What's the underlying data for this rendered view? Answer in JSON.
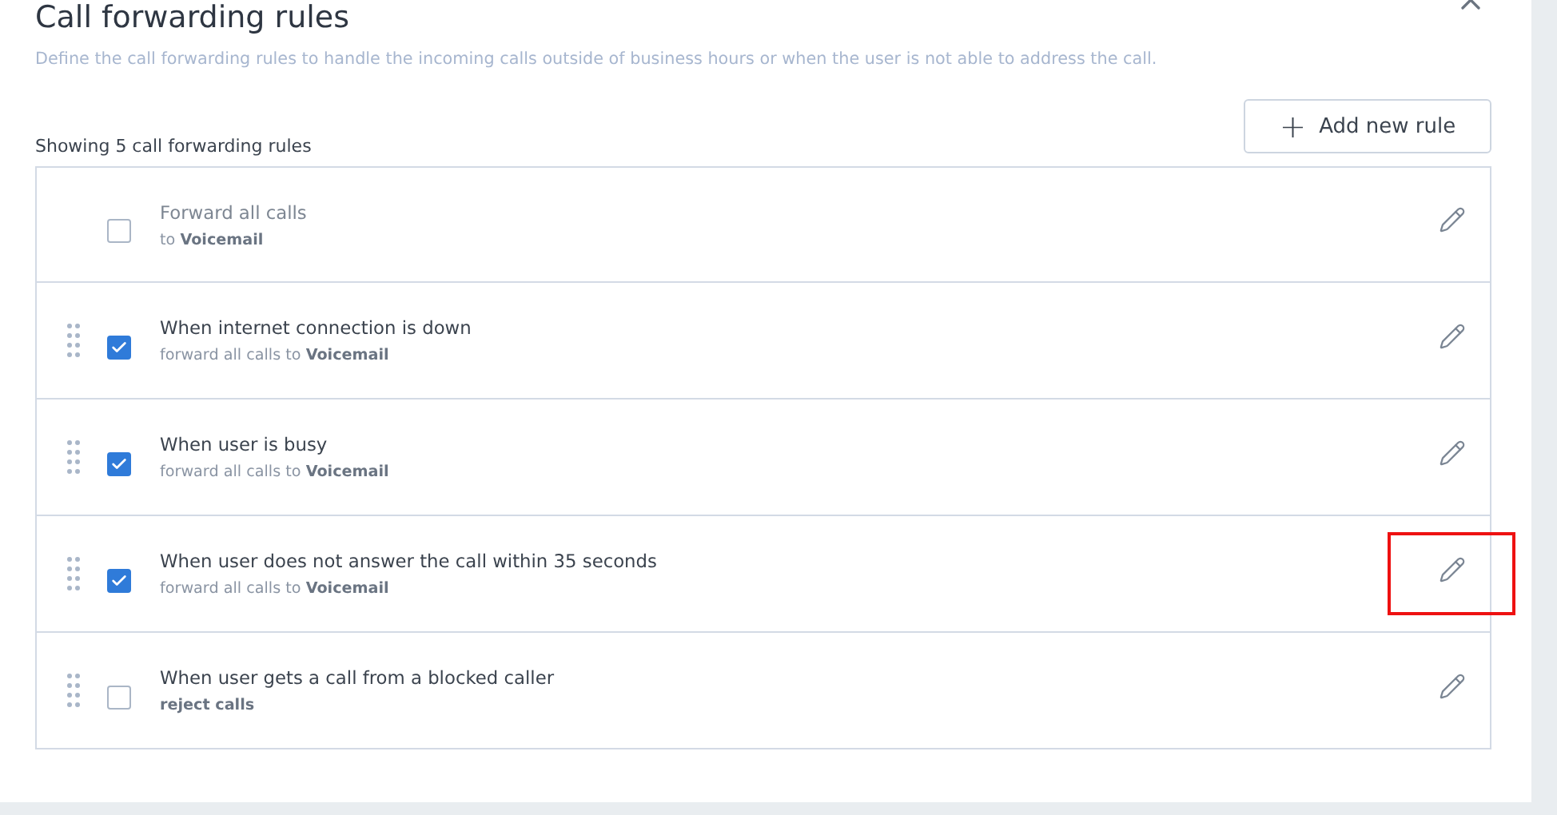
{
  "dialog": {
    "title": "Call forwarding rules",
    "description": "Define the call forwarding rules to handle the incoming calls outside of business hours or when the user is not able to address the call."
  },
  "summary": "Showing 5 call forwarding rules",
  "add_button": {
    "icon": "+",
    "label": "Add new rule"
  },
  "rules": [
    {
      "title": "Forward all calls",
      "detail": "to **Voicemail**",
      "checked": false,
      "draggable": false,
      "highlighted": false
    },
    {
      "title": "When internet connection is down",
      "detail": "forward all calls to **Voicemail**",
      "checked": true,
      "draggable": true,
      "highlighted": false
    },
    {
      "title": "When user is busy",
      "detail": "forward all calls to **Voicemail**",
      "checked": true,
      "draggable": true,
      "highlighted": false
    },
    {
      "title": "When user does not answer the call within 35 seconds",
      "detail": "forward all calls to **Voicemail**",
      "checked": true,
      "draggable": true,
      "highlighted": true
    },
    {
      "title": "When user gets a call from a blocked caller",
      "detail": "**reject calls**",
      "checked": false,
      "draggable": true,
      "highlighted": false
    }
  ]
}
